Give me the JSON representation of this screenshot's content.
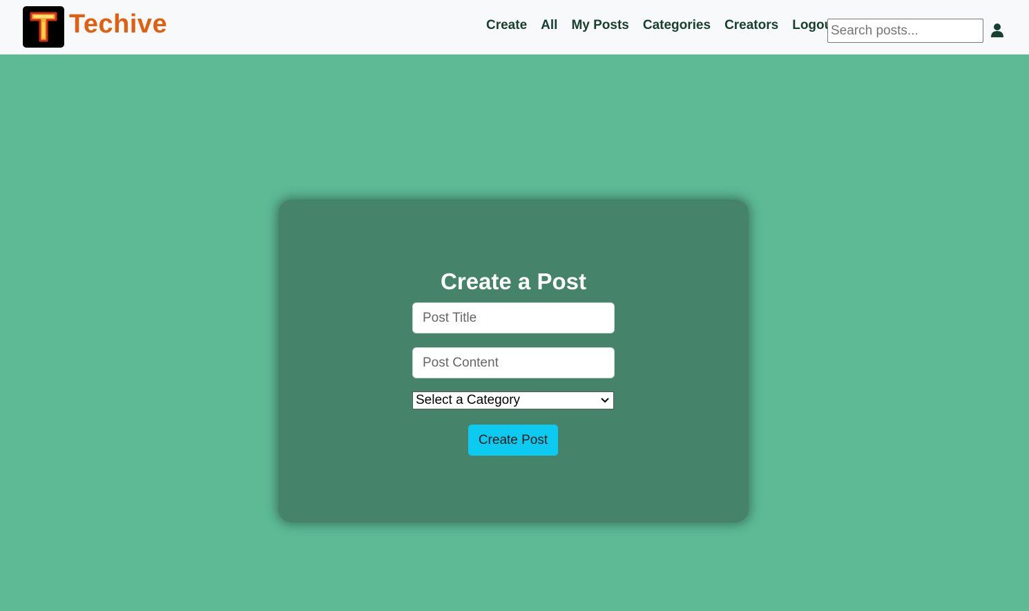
{
  "brand": {
    "logo_letter": "T",
    "name": "Techive",
    "color": "#e06010"
  },
  "nav": {
    "items": [
      {
        "label": "Create",
        "name": "nav-create"
      },
      {
        "label": "All",
        "name": "nav-all"
      },
      {
        "label": "My Posts",
        "name": "nav-my-posts"
      },
      {
        "label": "Categories",
        "name": "nav-categories"
      },
      {
        "label": "Creators",
        "name": "nav-creators"
      },
      {
        "label": "Logout",
        "name": "nav-logout"
      }
    ],
    "search_placeholder": "Search posts...",
    "search_value": "",
    "user_icon": "user-icon"
  },
  "form": {
    "title": "Create a Post",
    "title_placeholder": "Post Title",
    "content_placeholder": "Post Content",
    "category_selected": "Select a Category",
    "submit_label": "Create Post"
  },
  "colors": {
    "page_bg": "#5dba95",
    "card_bg": "#46836b",
    "nav_text": "#17402e",
    "button_bg": "#0dcaf0"
  }
}
